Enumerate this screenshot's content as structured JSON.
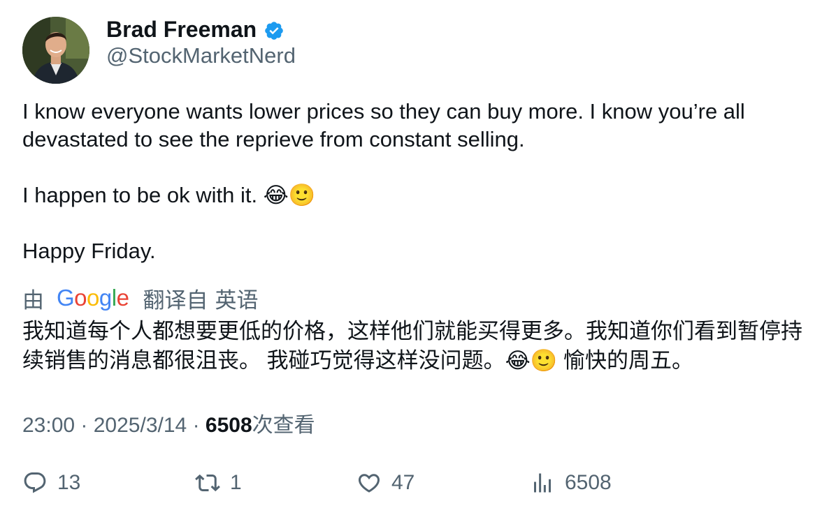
{
  "author": {
    "display_name": "Brad Freeman",
    "handle": "@StockMarketNerd",
    "verified": true,
    "avatar_icon": "profile-photo"
  },
  "tweet": {
    "paragraphs": [
      "I know everyone wants lower prices so they can buy more. I know you’re all devastated to see the reprieve from constant selling.",
      "I happen to be ok with it. 😂🙂",
      "Happy Friday."
    ]
  },
  "translation": {
    "by": "由",
    "provider": "Google",
    "label": "翻译自",
    "language": "英语",
    "text": "我知道每个人都想要更低的价格，这样他们就能买得更多。我知道你们看到暂停持续销售的消息都很沮丧。 我碰巧觉得这样没问题。😂🙂 愉快的周五。"
  },
  "meta": {
    "time": "23:00",
    "separator": "·",
    "date": "2025/3/14",
    "views_count": "6508",
    "views_label": "次查看"
  },
  "actions": {
    "replies": "13",
    "retweets": "1",
    "likes": "47",
    "views": "6508"
  },
  "colors": {
    "text_primary": "#0f1419",
    "text_secondary": "#536471",
    "verified_blue": "#1d9bf0"
  }
}
